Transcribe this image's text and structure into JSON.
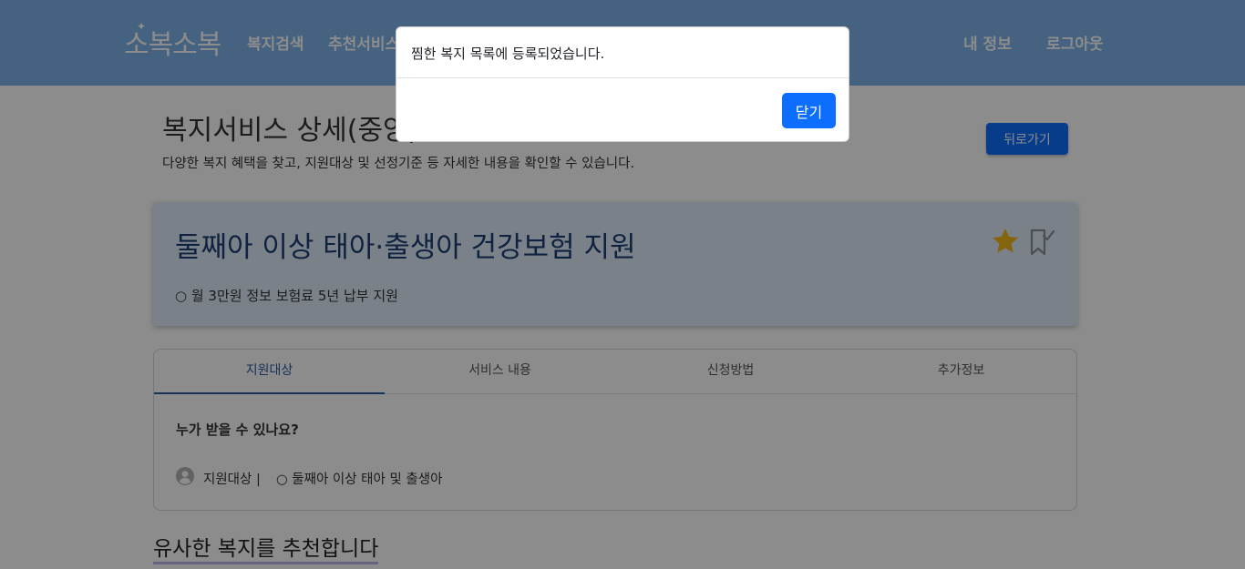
{
  "navbar": {
    "logo": "소복소복",
    "links": [
      "복지검색",
      "추천서비스"
    ],
    "right_links": [
      "내 정보",
      "로그아웃"
    ]
  },
  "page": {
    "title": "복지서비스 상세(중앙)",
    "subtitle": "다양한 복지 혜택을 찾고, 지원대상 및 선정기준 등 자세한 내용을 확인할 수 있습니다.",
    "back_label": "뒤로가기"
  },
  "service": {
    "title": "둘째아 이상 태아·출생아 건강보험 지원",
    "summary": "○ 월 3만원 정보 보험료 5년 납부 지원",
    "star_color": "#f0b619"
  },
  "tabs": [
    {
      "label": "지원대상",
      "active": true
    },
    {
      "label": "서비스 내용",
      "active": false
    },
    {
      "label": "신청방법",
      "active": false
    },
    {
      "label": "추가정보",
      "active": false
    }
  ],
  "target": {
    "heading": "누가 받을 수 있나요?",
    "label": "지원대상 |",
    "value": "○ 둘째아 이상 태아 및 출생아"
  },
  "similar": {
    "heading": "유사한 복지를 추천합니다"
  },
  "modal": {
    "message": "찜한 복지 목록에 등록되었습니다.",
    "close_label": "닫기"
  },
  "colors": {
    "navbar": "#7fb2ec",
    "primary": "#0d6efd",
    "card_bg": "#dfebf9",
    "active_tab": "#2b5aa5"
  }
}
